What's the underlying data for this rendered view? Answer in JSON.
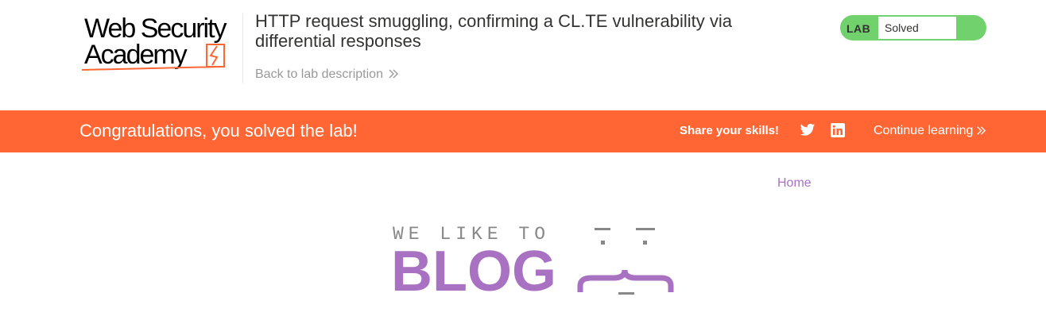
{
  "header": {
    "logo_line1": "Web Security",
    "logo_line2": "Academy",
    "lab_title": "HTTP request smuggling, confirming a CL.TE vulnerability via differential responses",
    "back_link": "Back to lab description"
  },
  "status": {
    "tag": "LAB",
    "value": "Solved",
    "color": "#70d16d"
  },
  "banner": {
    "message": "Congratulations, you solved the lab!",
    "share_label": "Share your skills!",
    "twitter_icon": "twitter-icon",
    "linkedin_icon": "linkedin-icon",
    "continue_label": "Continue learning",
    "color": "#ff6633"
  },
  "blog": {
    "home_link": "Home",
    "tagline": "WE LIKE TO",
    "title": "BLOG",
    "accent": "#a971c1"
  }
}
